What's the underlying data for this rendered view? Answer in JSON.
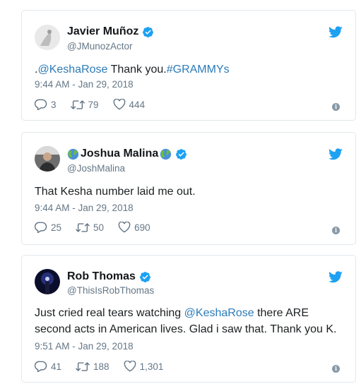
{
  "tweets": [
    {
      "name": "Javier Muñoz",
      "handle": "@JMunozActor",
      "text_prefix": ".",
      "mention": "@KeshaRose",
      "text_after": " Thank you.",
      "hashtag": "#GRAMMYs",
      "timestamp": "9:44 AM - Jan 29, 2018",
      "replies": "3",
      "retweets": "79",
      "likes": "444"
    },
    {
      "name": "Joshua Malina",
      "handle": "@JoshMalina",
      "text": "That Kesha number laid me out.",
      "timestamp": "9:44 AM - Jan 29, 2018",
      "replies": "25",
      "retweets": "50",
      "likes": "690"
    },
    {
      "name": "Rob Thomas",
      "handle": "@ThisIsRobThomas",
      "text_before": "Just cried real tears watching ",
      "mention": "@KeshaRose",
      "text_after": " there ARE",
      "text_line2": "second acts in American lives. Glad i saw that. Thank you K.",
      "timestamp": "9:51 AM - Jan 29, 2018",
      "replies": "41",
      "retweets": "188",
      "likes": "1,301"
    }
  ],
  "colors": {
    "link": "#2b7bb9",
    "twitter_blue": "#1da1f2",
    "verified": "#1da1f2",
    "muted": "#657786"
  },
  "icons": [
    "verified-badge-icon",
    "twitter-bird-icon",
    "reply-icon",
    "retweet-icon",
    "like-icon",
    "info-icon",
    "globe-icon"
  ]
}
